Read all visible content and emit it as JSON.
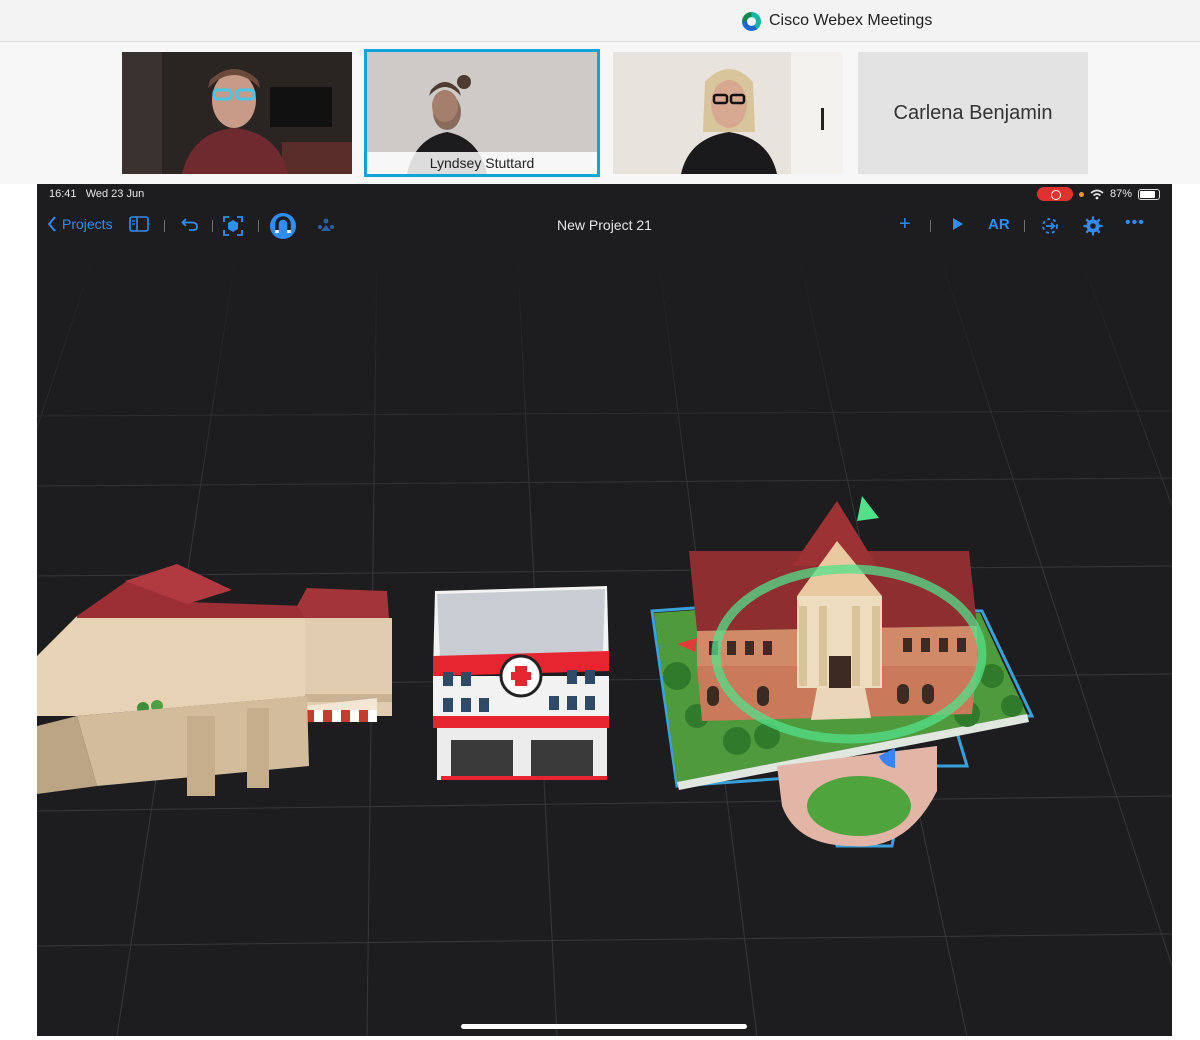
{
  "webex": {
    "app_title": "Cisco Webex Meetings"
  },
  "participants": [
    {
      "name": ""
    },
    {
      "name": "Lyndsey Stuttard"
    },
    {
      "name": ""
    },
    {
      "name": "Carlena Benjamin"
    }
  ],
  "ipad": {
    "status": {
      "time": "16:41",
      "date": "Wed 23 Jun",
      "battery": "87%"
    },
    "toolbar": {
      "back_label": "Projects",
      "title": "New Project 21",
      "ar_label": "AR",
      "add_icon": "+",
      "more_icon": "•••"
    },
    "colors": {
      "accent": "#2f8ef5",
      "background": "#1d1d20",
      "selection": "#3aa0d8",
      "gizmo_green": "#53e08a",
      "webex_highlight": "#14a3d8"
    },
    "scene": {
      "objects": [
        "market-building",
        "fire-station",
        "town-hall"
      ],
      "selected": "town-hall"
    }
  }
}
